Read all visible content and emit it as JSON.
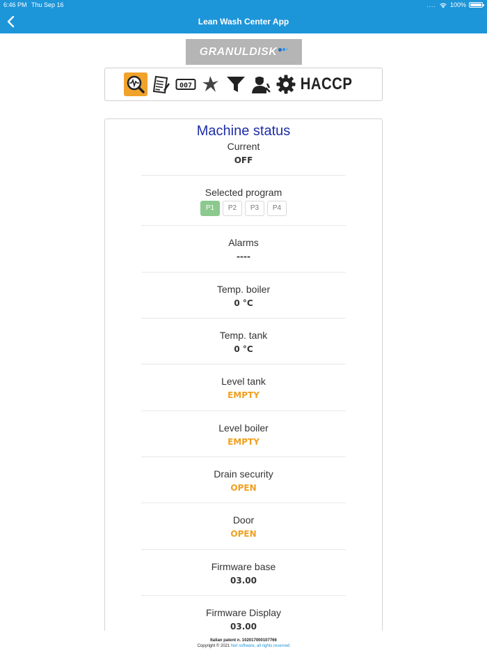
{
  "status_bar": {
    "time": "6:46 PM",
    "date": "Thu Sep 16",
    "signal_dots": "....",
    "battery_text": "100%"
  },
  "nav": {
    "title": "Lean Wash Center App",
    "back_icon": "chevron-left-icon"
  },
  "logo": {
    "text": "GRANULDISK"
  },
  "toolbar": {
    "items": [
      {
        "icon": "machine-status-icon",
        "active": true
      },
      {
        "icon": "report-icon",
        "active": false
      },
      {
        "icon": "counter-icon",
        "active": false
      },
      {
        "icon": "dispenser-icon",
        "active": false
      },
      {
        "icon": "filter-icon",
        "active": false
      },
      {
        "icon": "technician-icon",
        "active": false
      },
      {
        "icon": "settings-icon",
        "active": false
      }
    ],
    "haccp_label": "HACCP"
  },
  "machine_status": {
    "title": "Machine status",
    "current": {
      "label": "Current",
      "value": "OFF"
    },
    "program": {
      "label": "Selected program",
      "options": [
        "P1",
        "P2",
        "P3",
        "P4"
      ],
      "selected": "P1"
    },
    "alarms": {
      "label": "Alarms",
      "value": "----"
    },
    "temp_boiler": {
      "label": "Temp. boiler",
      "value": "0 °C"
    },
    "temp_tank": {
      "label": "Temp. tank",
      "value": "0 °C"
    },
    "level_tank": {
      "label": "Level tank",
      "value": "EMPTY"
    },
    "level_boiler": {
      "label": "Level boiler",
      "value": "EMPTY"
    },
    "drain_security": {
      "label": "Drain security",
      "value": "OPEN"
    },
    "door": {
      "label": "Door",
      "value": "OPEN"
    },
    "firmware_base": {
      "label": "Firmware base",
      "value": "03.00"
    },
    "firmware_display": {
      "label": "Firmware Display",
      "value": "03.00"
    }
  },
  "footer": {
    "patent": "Italian patent n. 102017000107766",
    "copyright": "Copyright © 2021",
    "link_text": "Net software, all rights reserved"
  },
  "colors": {
    "header_blue": "#1d95d9",
    "title_blue": "#1e2ea7",
    "warning_orange": "#f0a020",
    "selected_green": "#8cc98e",
    "active_tool": "#f1a22a"
  }
}
